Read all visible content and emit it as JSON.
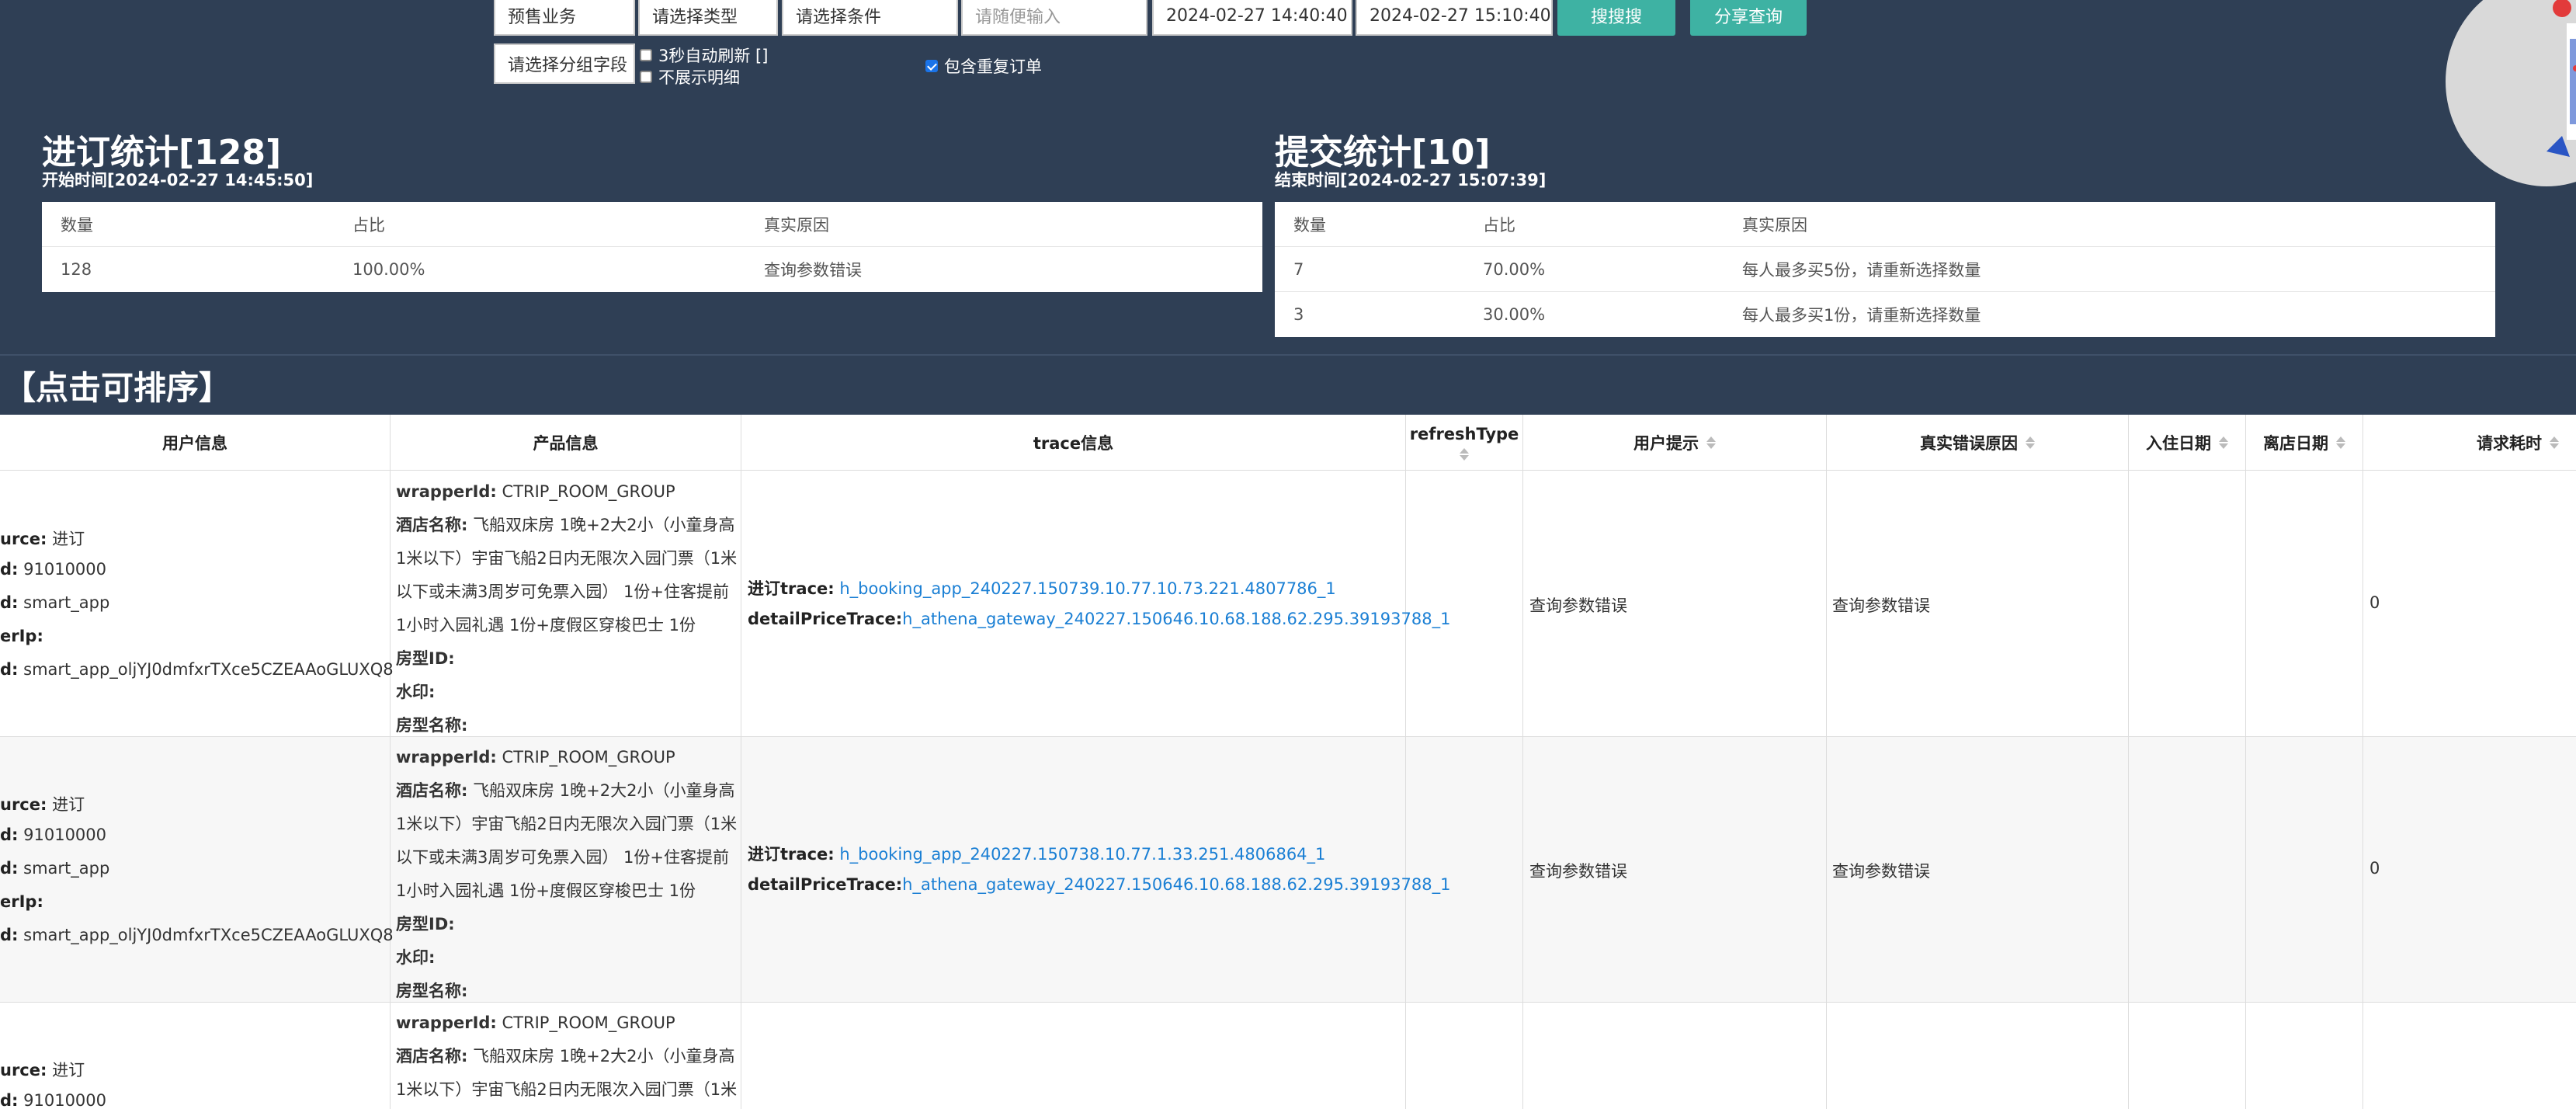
{
  "toolbar": {
    "business": "预售业务",
    "type_select": "请选择类型",
    "condition_select": "请选择条件",
    "free_input_placeholder": "请随便输入",
    "start_time": "2024-02-27 14:40:40",
    "end_time": "2024-02-27 15:10:40",
    "search_button": "搜搜搜",
    "share_button": "分享查询",
    "group_field_select": "请选择分组字段",
    "auto_refresh_label": "3秒自动刷新 []",
    "hide_detail_label": "不展示明细",
    "include_duplicate_label": "包含重复订单"
  },
  "order_stats": {
    "title": "进订统计[128]",
    "subtitle": "开始时间[2024-02-27 14:45:50]",
    "headers": [
      "数量",
      "占比",
      "真实原因"
    ],
    "rows": [
      [
        "128",
        "100.00%",
        "查询参数错误"
      ]
    ]
  },
  "submit_stats": {
    "title": "提交统计[10]",
    "subtitle": "结束时间[2024-02-27 15:07:39]",
    "headers": [
      "数量",
      "占比",
      "真实原因"
    ],
    "rows": [
      [
        "7",
        "70.00%",
        "每人最多买5份，请重新选择数量"
      ],
      [
        "3",
        "30.00%",
        "每人最多买1份，请重新选择数量"
      ]
    ]
  },
  "sort_title": "【点击可排序】",
  "table": {
    "headers": {
      "user_info": "用户信息",
      "product_info": "产品信息",
      "trace_info": "trace信息",
      "refresh_type": "refreshType",
      "user_hint": "用户提示",
      "real_error": "真实错误原因",
      "checkin": "入住日期",
      "checkout": "离店日期",
      "request_time": "请求耗时"
    },
    "rows": [
      {
        "user": {
          "source_label": "urce:",
          "source_value": "进订",
          "id_label": "d:",
          "id_value": "91010000",
          "app_label": "d:",
          "app_value": "smart_app",
          "ip_label": "erIp:",
          "ip_value": "",
          "uid_label": "d:",
          "uid_value": "smart_app_oljYJ0dmfxrTXce5CZEAAoGLUXQ8"
        },
        "product": {
          "wrapper_label": "wrapperId:",
          "wrapper_value": "CTRIP_ROOM_GROUP",
          "hotel_label": "酒店名称:",
          "hotel_value": "飞船双床房 1晚+2大2小（小童身高1米以下）宇宙飞船2日内无限次入园门票（1米以下或未满3周岁可免票入园） 1份+住客提前1小时入园礼遇 1份+度假区穿梭巴士 1份",
          "room_id_label": "房型ID:",
          "watermark_label": "水印:",
          "room_name_label": "房型名称:"
        },
        "trace": {
          "booking_label": "进订trace:",
          "booking_value": "h_booking_app_240227.150739.10.77.10.73.221.4807786_1",
          "detail_label": "detailPriceTrace:",
          "detail_value": "h_athena_gateway_240227.150646.10.68.188.62.295.39193788_1"
        },
        "user_hint": "查询参数错误",
        "real_error": "查询参数错误",
        "request_time": "0"
      },
      {
        "user": {
          "source_label": "urce:",
          "source_value": "进订",
          "id_label": "d:",
          "id_value": "91010000",
          "app_label": "d:",
          "app_value": "smart_app",
          "ip_label": "erIp:",
          "ip_value": "",
          "uid_label": "d:",
          "uid_value": "smart_app_oljYJ0dmfxrTXce5CZEAAoGLUXQ8"
        },
        "product": {
          "wrapper_label": "wrapperId:",
          "wrapper_value": "CTRIP_ROOM_GROUP",
          "hotel_label": "酒店名称:",
          "hotel_value": "飞船双床房 1晚+2大2小（小童身高1米以下）宇宙飞船2日内无限次入园门票（1米以下或未满3周岁可免票入园） 1份+住客提前1小时入园礼遇 1份+度假区穿梭巴士 1份",
          "room_id_label": "房型ID:",
          "watermark_label": "水印:",
          "room_name_label": "房型名称:"
        },
        "trace": {
          "booking_label": "进订trace:",
          "booking_value": "h_booking_app_240227.150738.10.77.1.33.251.4806864_1",
          "detail_label": "detailPriceTrace:",
          "detail_value": "h_athena_gateway_240227.150646.10.68.188.62.295.39193788_1"
        },
        "user_hint": "查询参数错误",
        "real_error": "查询参数错误",
        "request_time": "0"
      },
      {
        "user": {
          "source_label": "urce:",
          "source_value": "进订",
          "id_label": "d:",
          "id_value": "91010000"
        },
        "product": {
          "wrapper_label": "wrapperId:",
          "wrapper_value": "CTRIP_ROOM_GROUP",
          "hotel_label": "酒店名称:",
          "hotel_value": "飞船双床房 1晚+2大2小（小童身高1米以下）宇宙飞船2日内无限次入园门票（1米"
        }
      }
    ]
  },
  "colors": {
    "background": "#2f3f55",
    "button": "#3eb2a3",
    "link": "#1a7fd4"
  }
}
